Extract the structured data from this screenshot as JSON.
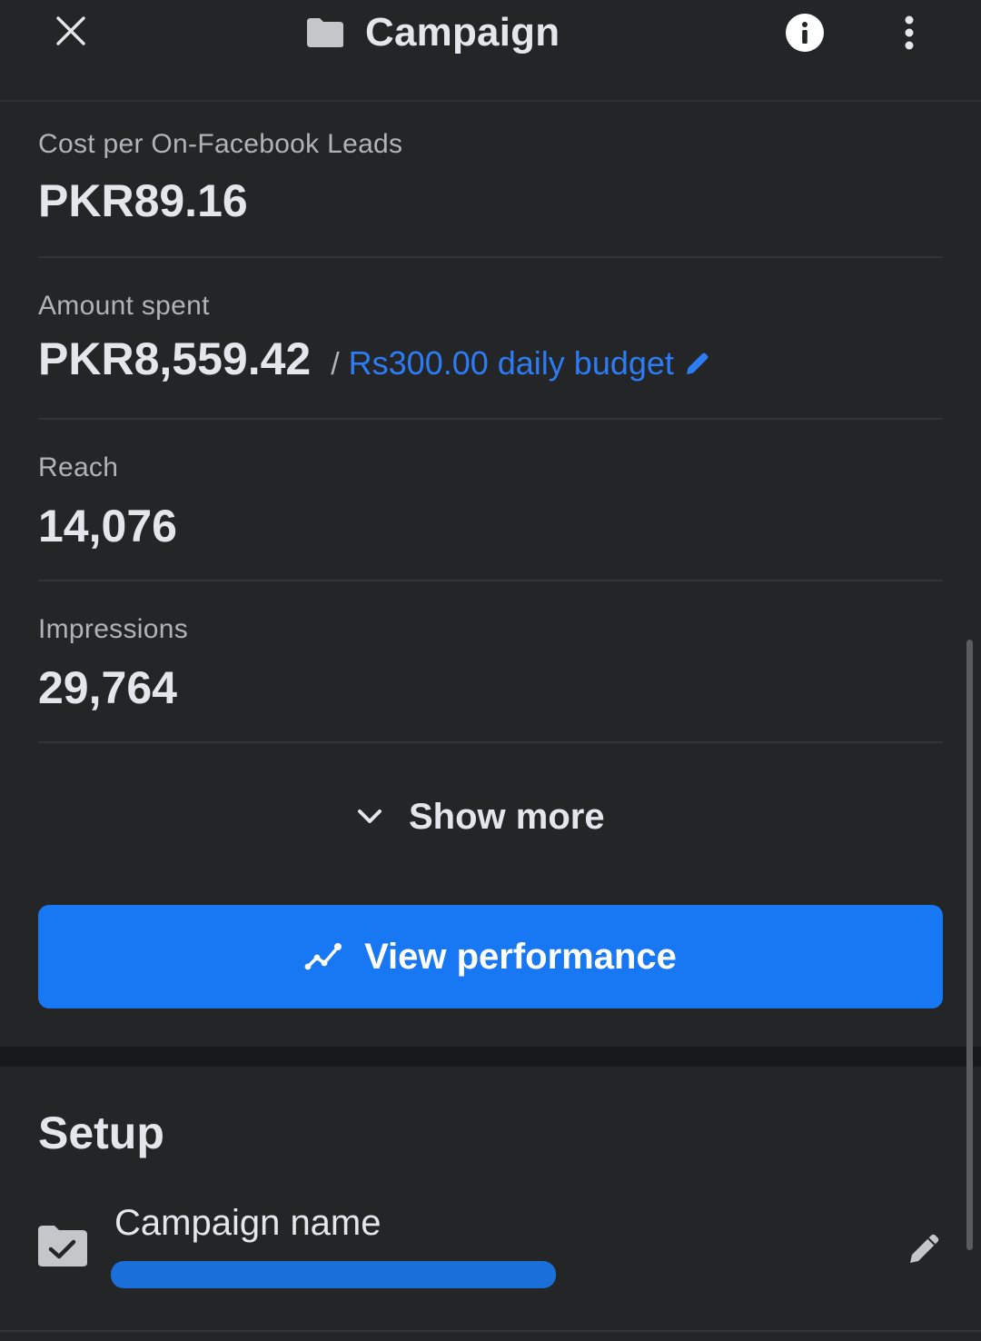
{
  "header": {
    "title": "Campaign",
    "close_icon": "close-icon",
    "folder_icon": "folder-icon",
    "info_icon": "info-icon",
    "more_icon": "more-vertical-icon"
  },
  "metrics": [
    {
      "label": "Cost per On-Facebook Leads",
      "value": "PKR89.16"
    },
    {
      "label": "Amount spent",
      "value": "PKR8,559.42"
    },
    {
      "label": "Reach",
      "value": "14,076"
    },
    {
      "label": "Impressions",
      "value": "29,764"
    }
  ],
  "budget": {
    "separator": "/",
    "link_text": "Rs300.00 daily budget",
    "edit_icon": "pencil-icon"
  },
  "show_more": {
    "label": "Show more",
    "icon": "chevron-down-icon"
  },
  "view_performance": {
    "label": "View performance",
    "icon": "trend-icon"
  },
  "setup": {
    "title": "Setup",
    "campaign_name": {
      "label": "Campaign name",
      "value_redacted": true,
      "icon": "folder-check-icon",
      "edit_icon": "pencil-icon"
    }
  },
  "colors": {
    "background": "#242526",
    "accent": "#1877f2",
    "link": "#2d7cf6",
    "text_primary": "#e4e6eb",
    "text_secondary": "#b0b3b8"
  }
}
